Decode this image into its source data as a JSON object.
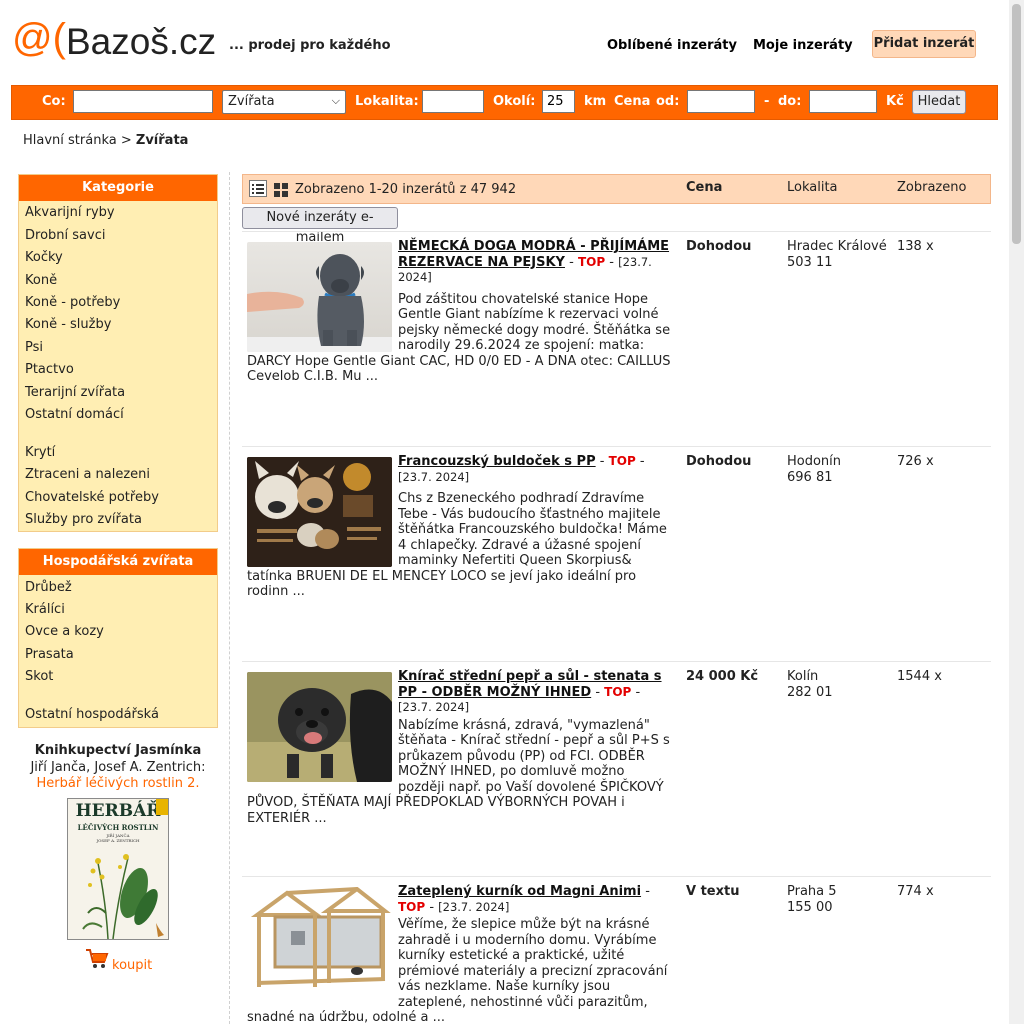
{
  "header": {
    "logo_at": "@(",
    "logo_text": "Bazoš.cz",
    "slogan": "... prodej pro každého",
    "favorites": "Oblíbené inzeráty",
    "my_ads": "Moje inzeráty",
    "add_ad": "Přidat inzerát"
  },
  "search": {
    "what_label": "Co:",
    "what_value": "",
    "category_selected": "Zvířata",
    "location_label": "Lokalita:",
    "location_value": "",
    "radius_label": "Okolí:",
    "radius_value": "25",
    "radius_unit": "km",
    "price_label": "Cena",
    "from_label": "od:",
    "dash": "-",
    "to_label": "do:",
    "currency": "Kč",
    "submit": "Hledat"
  },
  "breadcrumb": {
    "home": "Hlavní stránka",
    "sep": ">",
    "current": "Zvířata"
  },
  "sidebar": {
    "categories_title": "Kategorie",
    "categories": [
      "Akvarijní ryby",
      "Drobní savci",
      "Kočky",
      "Koně",
      "Koně - potřeby",
      "Koně - služby",
      "Psi",
      "Ptactvo",
      "Terarijní zvířata",
      "Ostatní domácí",
      "Krytí",
      "Ztraceni a nalezeni",
      "Chovatelské potřeby",
      "Služby pro zvířata"
    ],
    "farm_title": "Hospodářská zvířata",
    "farm": [
      "Drůbež",
      "Králíci",
      "Ovce a kozy",
      "Prasata",
      "Skot",
      "Ostatní hospodářská"
    ],
    "book": {
      "shop": "Knihkupectví Jasmínka",
      "authors": "Jiří Janča, Josef A. Zentrich:",
      "title": "Herbář léčivých rostlin 2.",
      "cover_title": "HERBÁŘ",
      "cover_sub": "LÉČIVÝCH ROSTLIN",
      "cover_authors": "JIŘÍ JANČA",
      "cover_authors2": "JOSEF A. ZENTRICH",
      "buy": "koupit"
    }
  },
  "listing": {
    "summary": "Zobrazeno 1-20 inzerátů z 47 942",
    "col_price": "Cena",
    "col_location": "Lokalita",
    "col_views": "Zobrazeno",
    "email_button": "Nové inzeráty e-mailem",
    "top_label": "TOP",
    "ads": [
      {
        "title": "NĚMECKÁ DOGA MODRÁ - PŘIJÍMÁME REZERVACE NA PEJSKY",
        "date": "[23.7. 2024]",
        "desc": "Pod záštitou chovatelské stanice Hope Gentle Giant nabízíme k rezervaci volné pejsky německé dogy modré. Štěňátka se narodily 29.6.2024 ze spojení: matka: DARCY Hope Gentle Giant CAC, HD 0/0 ED - A DNA otec: CAILLUS Cevelob C.I.B. Mu ...",
        "price": "Dohodou",
        "city": "Hradec Králové",
        "zip": "503 11",
        "views": "138 x"
      },
      {
        "title": "Francouzský buldoček s PP",
        "date": "[23.7. 2024]",
        "desc": "Chs z Bzeneckého podhradí Zdravíme Tebe - Vás budoucího šťastného majitele štěňátka Francouzského buldočka! Máme 4 chlapečky. Zdravé a úžasné spojení maminky Nefertiti Queen Skorpius& tatínka BRUENI DE EL MENCEY LOCO se jeví jako ideální pro rodinn ...",
        "price": "Dohodou",
        "city": "Hodonín",
        "zip": "696 81",
        "views": "726 x"
      },
      {
        "title": "Knírač střední pepř a sůl - stenata s PP - ODBĚR MOŽNÝ IHNED",
        "date": "[23.7. 2024]",
        "desc": "Nabízíme krásná, zdravá, \"vymazlená\" štěňata - Knírač střední - pepř a sůl P+S s průkazem původu (PP) od FCI. ODBĚR MOŽNÝ IHNED, po domluvě možno později např. po Vaší dovolené ŠPIČKOVÝ PŮVOD, ŠTĚŇATA MAJÍ PŘEDPOKLAD VÝBORNÝCH POVAH i EXTERIÉR ...",
        "price": "24 000 Kč",
        "city": "Kolín",
        "zip": "282 01",
        "views": "1544 x"
      },
      {
        "title": "Zateplený kurník od Magni Animi",
        "date": "[23.7. 2024]",
        "desc": "Věříme, že slepice může být na krásné zahradě i u moderního domu. Vyrábíme kurníky estetické a praktické, užité prémiové materiály a precizní zpracování vás nezklame. Naše kurníky jsou zateplené, nehostinné vůči parazitům, snadné na údržbu, odolné a ...",
        "price": "V textu",
        "city": "Praha 5",
        "zip": "155 00",
        "views": "774 x"
      }
    ]
  },
  "colors": {
    "brand": "#ff6600",
    "sidebar_bg": "#ffeeb3",
    "header_bg": "#ffd8b8",
    "top": "#e30000"
  }
}
